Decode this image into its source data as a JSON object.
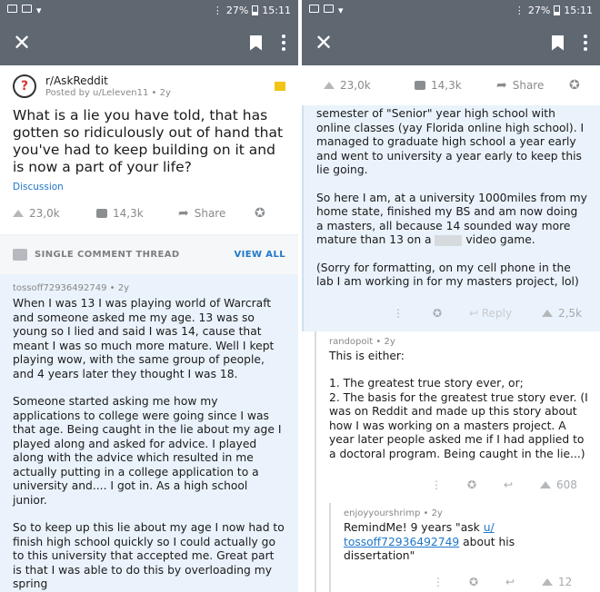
{
  "status": {
    "battery": "27%",
    "time": "15:11"
  },
  "left": {
    "subreddit": "r/AskReddit",
    "posted_by": "Posted by u/Leleven11 • 2y",
    "title": "What is a lie you have told, that has gotten so ridiculously out of hand that you've had to keep building on it and is now a part of your life?",
    "flair": "Discussion",
    "upvotes": "23,0k",
    "comments": "14,3k",
    "share": "Share",
    "thread_label": "SINGLE COMMENT THREAD",
    "view_all": "VIEW ALL",
    "comment_author": "tossoff72936492749 • 2y",
    "comment_paragraphs": [
      "When I was 13 I was playing world of Warcraft and someone asked me my age. 13 was so young so I lied and said I was 14, cause that meant I was so much more mature. Well I kept playing wow, with the same group of people, and 4 years later they thought I was 18.",
      "Someone started asking me how my applications to college were going since I was that age. Being caught in the lie about my age I played along and asked for advice. I played along with the advice which resulted in me actually putting in a college application to a university and.... I got in. As a high school junior.",
      "So to keep up this lie about my age I now had to finish high school quickly so I could actually go to this university that accepted me. Great part is that I was able to do this by overloading my spring"
    ]
  },
  "right": {
    "upvotes": "23,0k",
    "comments": "14,3k",
    "share": "Share",
    "continued_p1": "semester of \"Senior\" year high school with online classes (yay Florida online high school). I managed to graduate high school a year early and went to university a year early to keep this lie going.",
    "continued_p2a": "So here I am, at a university 1000miles from my home state, finished my BS and am now doing a masters, all because 14 sounded way more mature than 13 on a",
    "continued_p2b": "video game.",
    "continued_p3": "(Sorry for formatting, on my cell phone in the lab I am working in for my masters project, lol)",
    "c1_reply": "Reply",
    "c1_score": "2,5k",
    "r1_author": "randopoit • 2y",
    "r1_p1": "This is either:",
    "r1_p2": "1. The greatest true story ever, or;\n2. The basis for the greatest true story ever. (I was on Reddit and made up this story about how I was working on a masters project. A year later people asked me if I had applied to a doctoral program. Being caught in the lie...)",
    "r1_score": "608",
    "r2_author": "enjoyyourshrimp • 2y",
    "r2_text_a": "RemindMe! 9 years \"ask ",
    "r2_link1": "u/",
    "r2_link2": "tossoff72936492749",
    "r2_text_b": " about his dissertation\"",
    "r2_score": "12"
  }
}
